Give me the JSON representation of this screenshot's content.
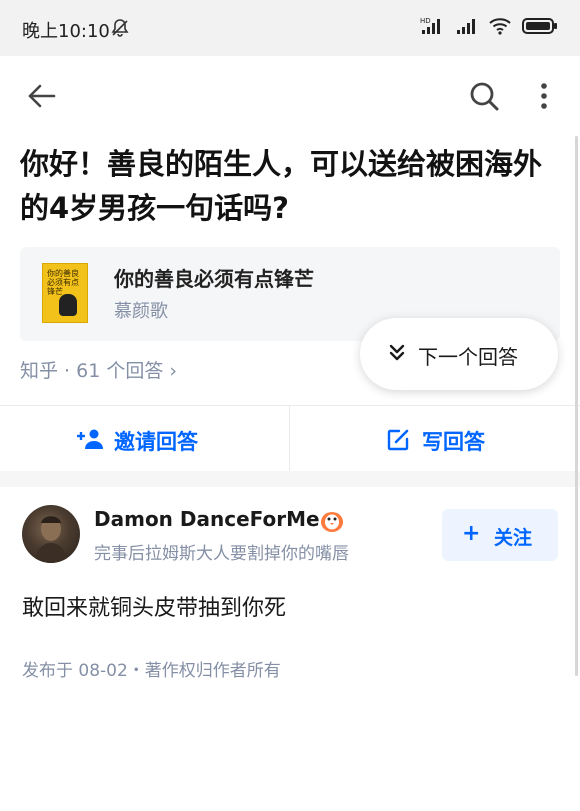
{
  "status_bar": {
    "time": "晚上10:10",
    "icons": [
      "mute-bell-icon",
      "hd-signal-icon",
      "signal-icon",
      "wifi-icon",
      "battery-icon"
    ]
  },
  "nav": {
    "back_icon": "arrow-left-icon",
    "search_icon": "search-icon",
    "more_icon": "more-vertical-icon"
  },
  "question": {
    "title": "你好！善良的陌生人，可以送给被困海外的4岁男孩一句话吗?"
  },
  "book_card": {
    "cover_text": "你的善良必须有点锋芒",
    "title": "你的善良必须有点锋芒",
    "author": "慕颜歌"
  },
  "meta": {
    "source_answers": "知乎 · 61 个回答 ›"
  },
  "next_answer": {
    "label": "下一个回答",
    "icon": "double-chevron-down-icon"
  },
  "actions": {
    "invite_label": "邀请回答",
    "invite_icon": "add-user-icon",
    "write_label": "写回答",
    "write_icon": "edit-icon"
  },
  "answer": {
    "author_name": "Damon DanceForMe",
    "author_bio": "完事后拉姆斯大人要割掉你的嘴唇",
    "follow_label": "关注",
    "content": "敢回来就铜头皮带抽到你死",
    "published": "发布于 08-02・著作权归作者所有"
  },
  "colors": {
    "accent": "#0066ff",
    "muted_text": "#8590a6",
    "status_bar_bg": "#f2f2f2"
  }
}
